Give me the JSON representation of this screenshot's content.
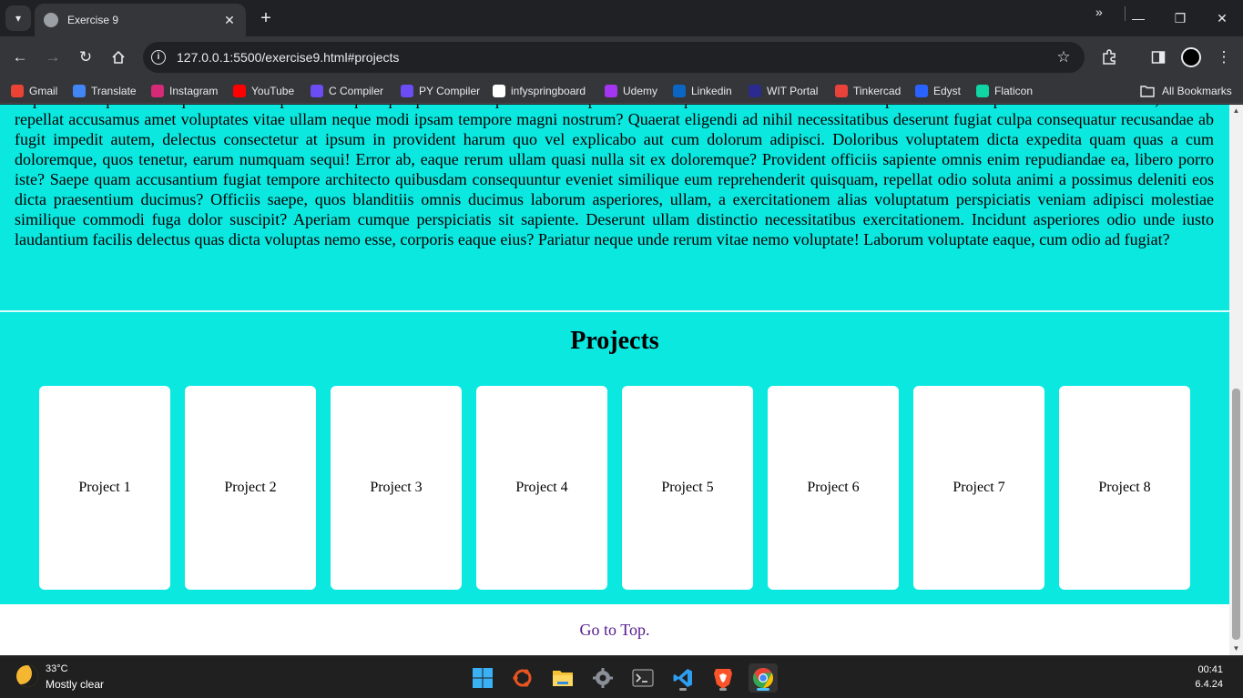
{
  "browser": {
    "tab_title": "Exercise 9",
    "tab_close": "✕",
    "new_tab": "+",
    "url": "127.0.0.1:5500/exercise9.html#projects",
    "bookmarks": [
      {
        "label": "Gmail",
        "icon": "gmail-icon",
        "color": "#ea4335"
      },
      {
        "label": "Translate",
        "icon": "translate-icon",
        "color": "#4285f4"
      },
      {
        "label": "Instagram",
        "icon": "instagram-icon",
        "color": "#d62976"
      },
      {
        "label": "YouTube",
        "icon": "youtube-icon",
        "color": "#ff0000"
      },
      {
        "label": "C Compiler",
        "icon": "c-compiler-icon",
        "color": "#6c4cf5"
      },
      {
        "label": "PY Compiler",
        "icon": "py-compiler-icon",
        "color": "#6c4cf5"
      },
      {
        "label": "infyspringboard",
        "icon": "infyspringboard-icon",
        "color": "#ffffff"
      },
      {
        "label": "Udemy",
        "icon": "udemy-icon",
        "color": "#a435f0"
      },
      {
        "label": "Linkedin",
        "icon": "linkedin-icon",
        "color": "#0a66c2"
      },
      {
        "label": "WIT Portal",
        "icon": "wit-portal-icon",
        "color": "#2b2b8f"
      },
      {
        "label": "Tinkercad",
        "icon": "tinkercad-icon",
        "color": "#e9423b"
      },
      {
        "label": "Edyst",
        "icon": "edyst-icon",
        "color": "#2962ff"
      },
      {
        "label": "Flaticon",
        "icon": "flaticon-icon",
        "color": "#0fd4a3"
      }
    ],
    "bookmarks_more": "»",
    "all_bookmarks": "All Bookmarks"
  },
  "page": {
    "about_text": "Repellendus quod consequatur aut voluptatum ut quia quisquam similique amet excepturi doloremque rerum enim sit blanditiis ipsa consectetur perferendis accusantium, deleniti repellat accusamus amet voluptates vitae ullam neque modi ipsam tempore magni nostrum? Quaerat eligendi ad nihil necessitatibus deserunt fugiat culpa consequatur recusandae ab fugit impedit autem, delectus consectetur at ipsum in provident harum quo vel explicabo aut cum dolorum adipisci. Doloribus voluptatem dicta expedita quam quas a cum doloremque, quos tenetur, earum numquam sequi! Error ab, eaque rerum ullam quasi nulla sit ex doloremque? Provident officiis sapiente omnis enim repudiandae ea, libero porro iste? Saepe quam accusantium fugiat tempore architecto quibusdam consequuntur eveniet similique eum reprehenderit quisquam, repellat odio soluta animi a possimus deleniti eos dicta praesentium ducimus? Officiis saepe, quos blanditiis omnis ducimus laborum asperiores, ullam, a exercitationem alias voluptatum perspiciatis veniam adipisci molestiae similique commodi fuga dolor suscipit? Aperiam cumque perspiciatis sit sapiente. Deserunt ullam distinctio necessitatibus exercitationem. Incidunt asperiores odio unde iusto laudantium facilis delectus quas dicta voluptas nemo esse, corporis eaque eius? Pariatur neque unde rerum vitae nemo voluptate! Laborum voluptate eaque, cum odio ad fugiat?",
    "projects_heading": "Projects",
    "projects": [
      "Project 1",
      "Project 2",
      "Project 3",
      "Project 4",
      "Project 5",
      "Project 6",
      "Project 7",
      "Project 8"
    ],
    "footer_link": "Go to Top.",
    "background_color": "#0ae8e0"
  },
  "taskbar": {
    "temperature": "33°C",
    "weather": "Mostly clear",
    "time": "00:41",
    "date": "6.4.24",
    "apps": [
      "windows-start-icon",
      "ubuntu-icon",
      "file-explorer-icon",
      "settings-icon",
      "terminal-icon",
      "vscode-icon",
      "brave-icon",
      "chrome-icon"
    ]
  }
}
